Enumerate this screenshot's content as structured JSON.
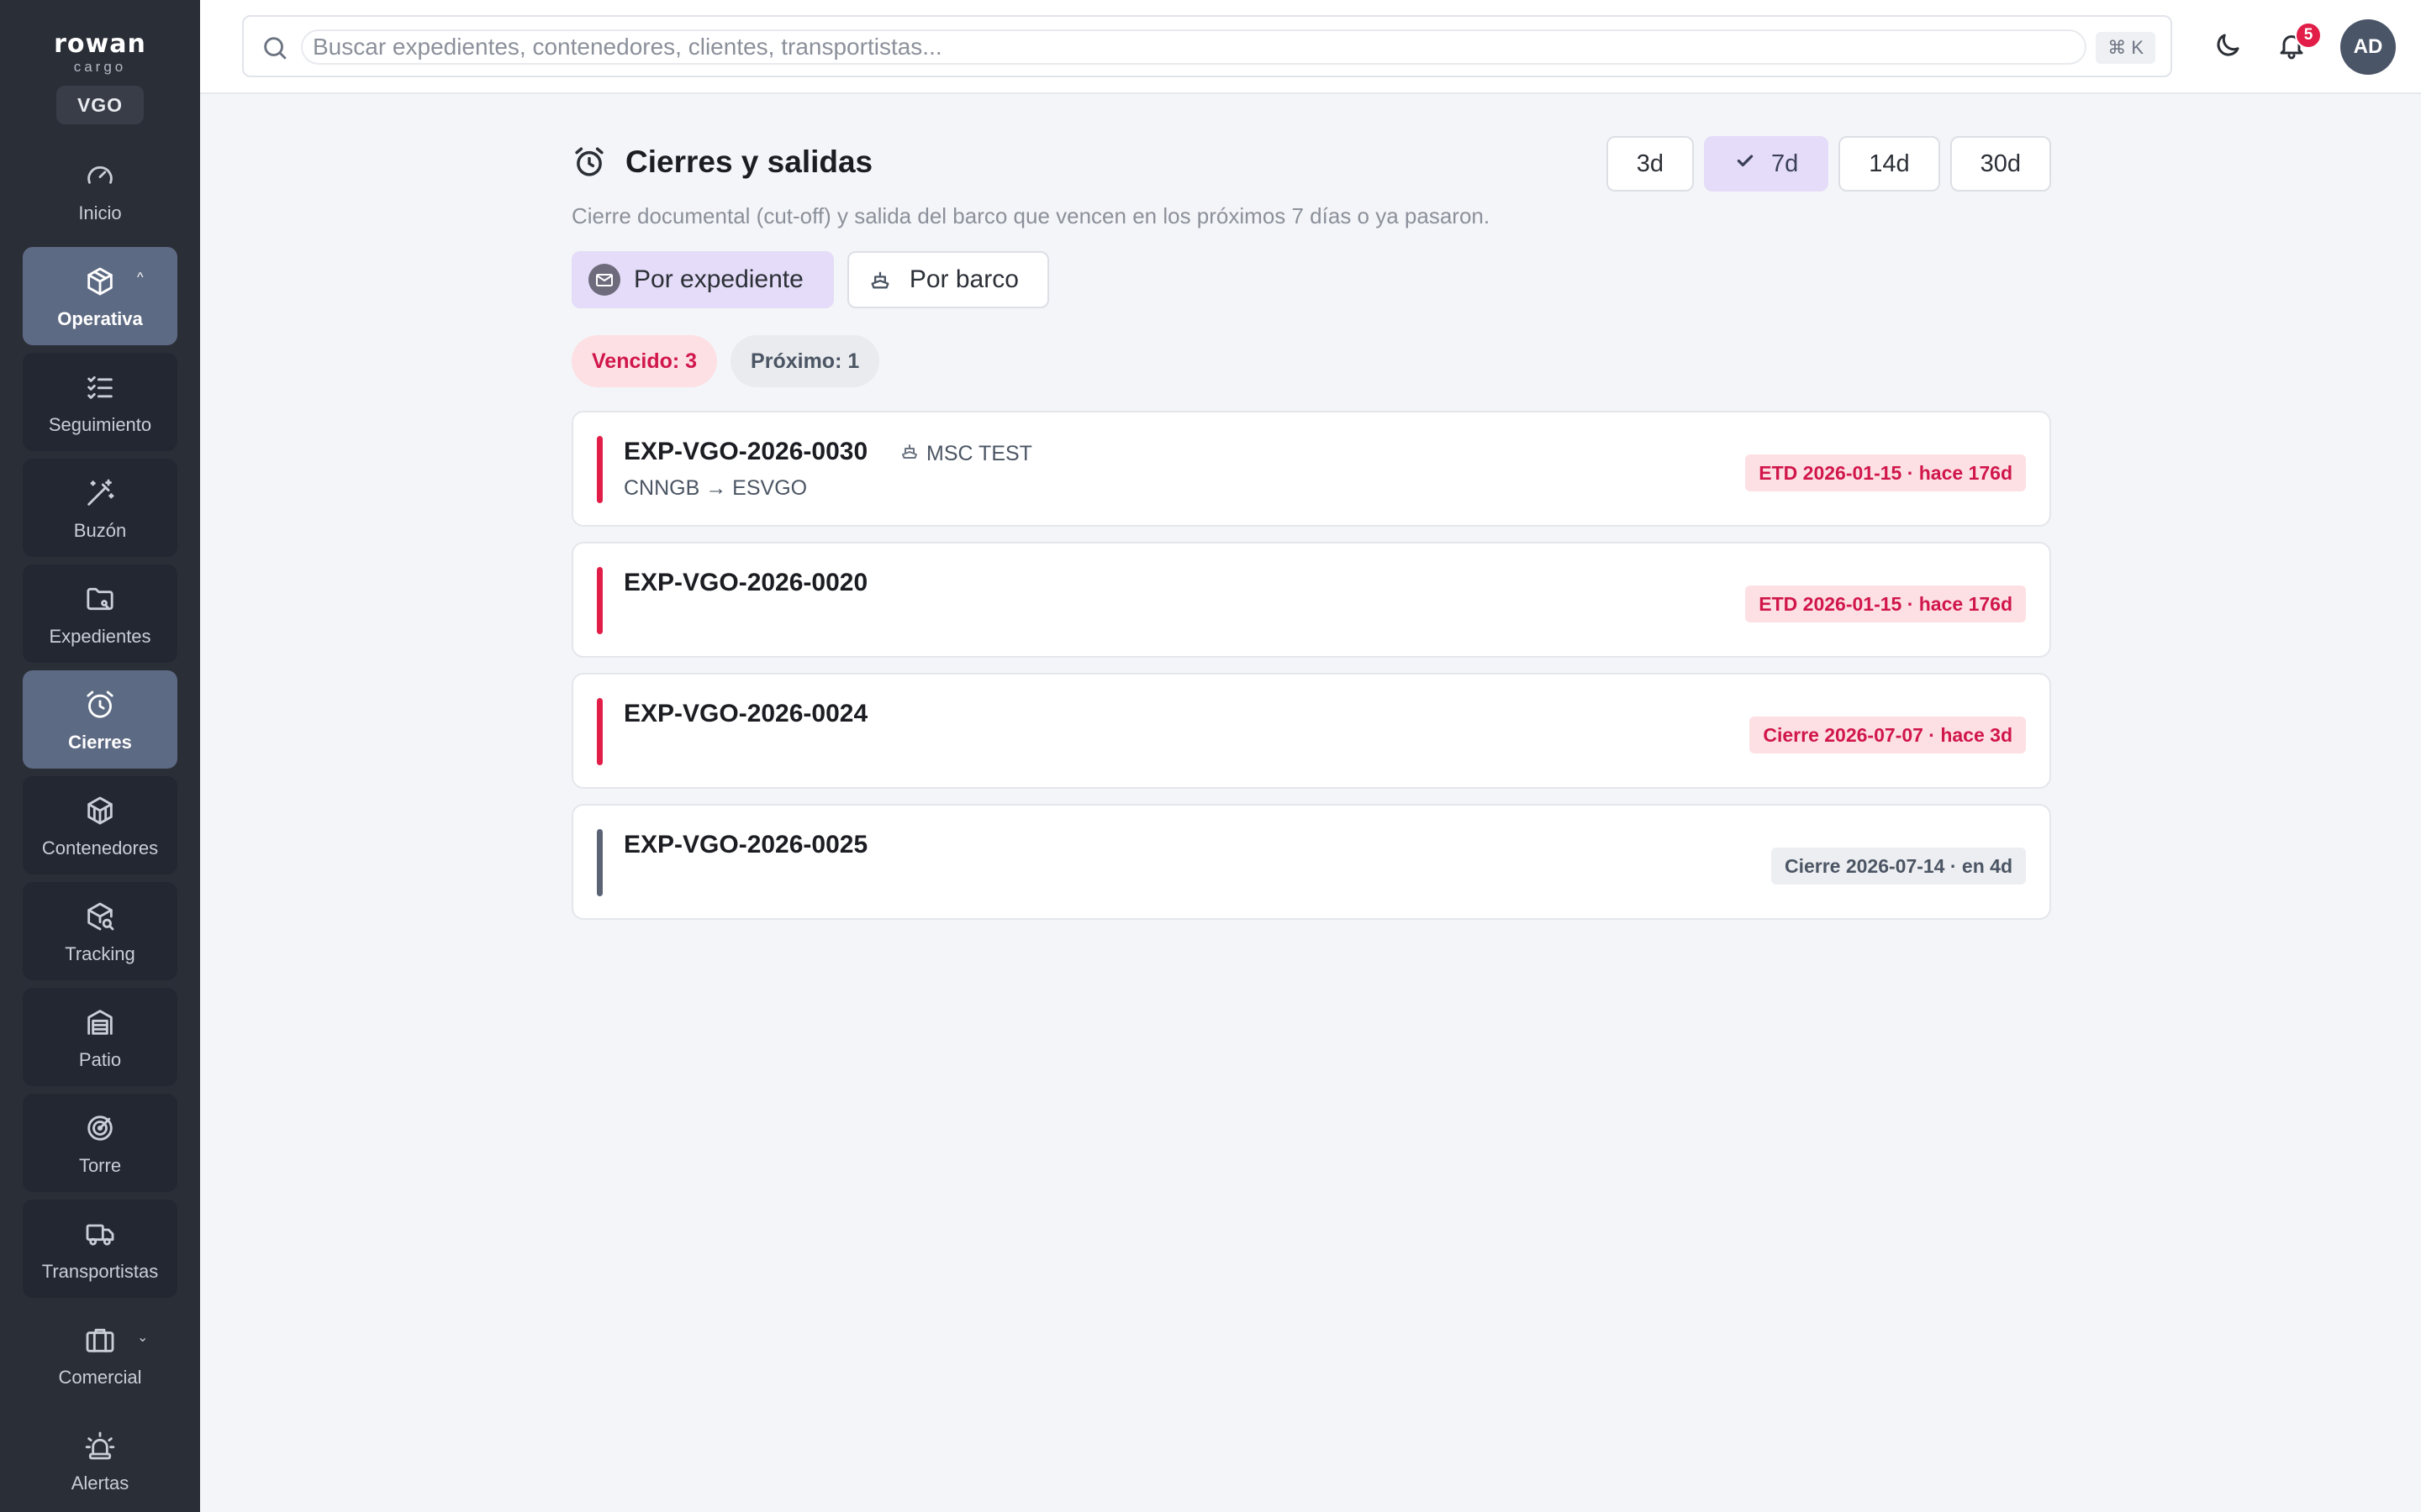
{
  "brand": {
    "name": "rowan",
    "sub": "cargo",
    "site": "VGO"
  },
  "nav": [
    {
      "id": "inicio",
      "label": "Inicio",
      "icon": "gauge-icon",
      "style": "plain"
    },
    {
      "id": "operativa",
      "label": "Operativa",
      "icon": "package-icon",
      "style": "active",
      "caret": "^"
    },
    {
      "id": "seguimiento",
      "label": "Seguimiento",
      "icon": "checklist-icon",
      "style": "dark"
    },
    {
      "id": "buzon",
      "label": "Buzón",
      "icon": "magic-wand-icon",
      "style": "dark"
    },
    {
      "id": "expedientes",
      "label": "Expedientes",
      "icon": "folder-icon",
      "style": "dark"
    },
    {
      "id": "cierres",
      "label": "Cierres",
      "icon": "alarm-clock-icon",
      "style": "active"
    },
    {
      "id": "contenedores",
      "label": "Contenedores",
      "icon": "container-icon",
      "style": "dark"
    },
    {
      "id": "tracking",
      "label": "Tracking",
      "icon": "package-search-icon",
      "style": "dark"
    },
    {
      "id": "patio",
      "label": "Patio",
      "icon": "warehouse-icon",
      "style": "dark"
    },
    {
      "id": "torre",
      "label": "Torre",
      "icon": "radar-icon",
      "style": "dark"
    },
    {
      "id": "transportistas",
      "label": "Transportistas",
      "icon": "truck-icon",
      "style": "dark"
    },
    {
      "id": "comercial",
      "label": "Comercial",
      "icon": "briefcase-icon",
      "style": "plain",
      "caret": "⌄"
    },
    {
      "id": "alertas",
      "label": "Alertas",
      "icon": "siren-icon",
      "style": "plain"
    }
  ],
  "search": {
    "placeholder": "Buscar expedientes, contenedores, clientes, transportistas...",
    "shortcut": "⌘ K"
  },
  "topbar": {
    "notifications": "5",
    "avatar": "AD"
  },
  "page": {
    "title": "Cierres y salidas",
    "subtitle": "Cierre documental (cut-off) y salida del barco que vencen en los próximos 7 días o ya pasaron.",
    "ranges": [
      {
        "label": "3d",
        "selected": false
      },
      {
        "label": "7d",
        "selected": true
      },
      {
        "label": "14d",
        "selected": false
      },
      {
        "label": "30d",
        "selected": false
      }
    ],
    "views": [
      {
        "label": "Por expediente",
        "selected": true,
        "icon": "mail-icon"
      },
      {
        "label": "Por barco",
        "selected": false,
        "icon": "ship-icon"
      }
    ],
    "counts": {
      "overdue": "Vencido: 3",
      "upcoming": "Próximo: 1"
    }
  },
  "items": [
    {
      "exp": "EXP-VGO-2026-0030",
      "vessel": "MSC TEST",
      "route": "CNNGB → ESVGO",
      "status": "ETD 2026-01-15 · hace 176d",
      "state": "overdue"
    },
    {
      "exp": "EXP-VGO-2026-0020",
      "vessel": "",
      "route": "",
      "status": "ETD 2026-01-15 · hace 176d",
      "state": "overdue"
    },
    {
      "exp": "EXP-VGO-2026-0024",
      "vessel": "",
      "route": "",
      "status": "Cierre 2026-07-07 · hace 3d",
      "state": "overdue"
    },
    {
      "exp": "EXP-VGO-2026-0025",
      "vessel": "",
      "route": "",
      "status": "Cierre 2026-07-14 · en 4d",
      "state": "upcoming"
    }
  ],
  "colors": {
    "sidebar": "#2a2e37",
    "active_nav": "#5d6a83",
    "accent_selected": "#e4dcf8",
    "overdue": "#e11d48",
    "upcoming": "#5b6475"
  }
}
